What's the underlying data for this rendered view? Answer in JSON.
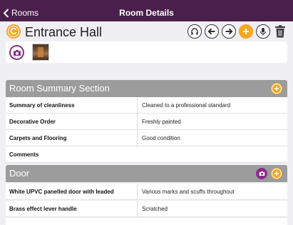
{
  "nav": {
    "back_label": "Rooms",
    "title": "Room Details"
  },
  "room": {
    "badge": "C",
    "name": "Entrance Hall"
  },
  "sections": {
    "summary": {
      "title": "Room Summary Section",
      "rows": [
        {
          "label": "Summary of cleanliness",
          "value": "Cleaned to a professional standard"
        },
        {
          "label": "Decorative Order",
          "value": "Freshly painted"
        },
        {
          "label": "Carpets and Flooring",
          "value": "Good condition"
        },
        {
          "label": "Comments",
          "value": ""
        }
      ]
    },
    "door": {
      "title": "Door",
      "rows": [
        {
          "label": "White UPVC panelled door with leaded",
          "value": "Various marks and scuffs throughout"
        },
        {
          "label": "Brass effect lever handle",
          "value": "Scratched"
        },
        {
          "label": "",
          "value": ""
        }
      ]
    }
  },
  "colors": {
    "nav": "#4b1f4b",
    "accent": "#f5a623",
    "camera": "#8b2c8b",
    "section_header": "#9c9c9c"
  },
  "icons": [
    "chevron-left-icon",
    "headphones-icon",
    "arrow-left-icon",
    "arrow-right-icon",
    "plus-icon",
    "microphone-icon",
    "trash-icon",
    "camera-icon"
  ]
}
